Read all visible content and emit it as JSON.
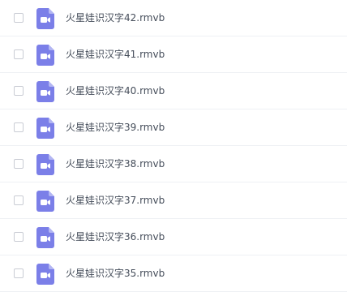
{
  "icons": {
    "row_icon": "video-file-icon",
    "icon_color": "#7b7fe8",
    "icon_fold_color": "#b3b6f3"
  },
  "files": [
    {
      "name": "火星娃识汉字42.rmvb"
    },
    {
      "name": "火星娃识汉字41.rmvb"
    },
    {
      "name": "火星娃识汉字40.rmvb"
    },
    {
      "name": "火星娃识汉字39.rmvb"
    },
    {
      "name": "火星娃识汉字38.rmvb"
    },
    {
      "name": "火星娃识汉字37.rmvb"
    },
    {
      "name": "火星娃识汉字36.rmvb"
    },
    {
      "name": "火星娃识汉字35.rmvb"
    }
  ]
}
